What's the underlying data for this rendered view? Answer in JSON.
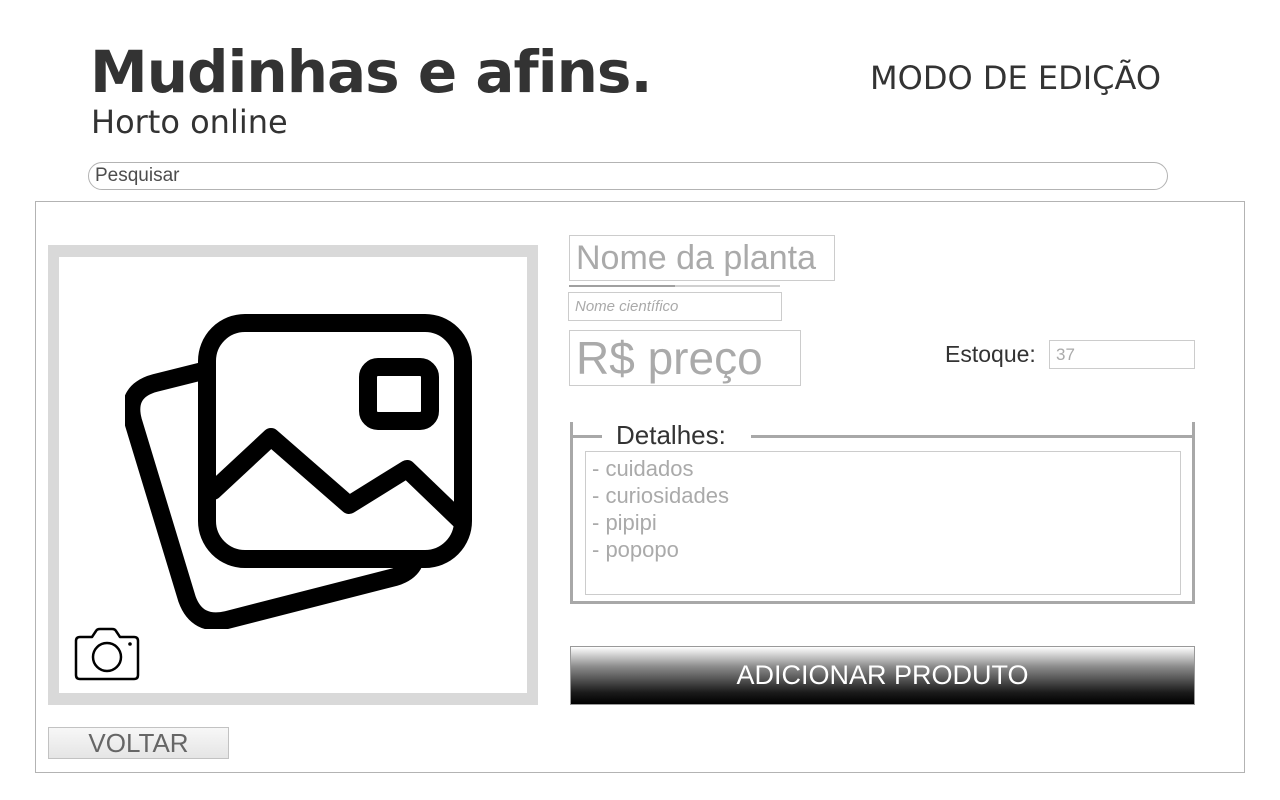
{
  "header": {
    "title": "Mudinhas e afins.",
    "subtitle": "Horto online",
    "mode": "MODO DE EDIÇÃO"
  },
  "search": {
    "placeholder": "Pesquisar",
    "icon": "search"
  },
  "product_form": {
    "image": {
      "placeholder_icon": "image-gallery-icon",
      "upload_icon": "camera-icon"
    },
    "name_placeholder": "Nome da planta",
    "scientific_name_placeholder": "Nome científico",
    "price_placeholder": "R$ preço",
    "stock": {
      "label": "Estoque:",
      "placeholder": "37"
    },
    "details": {
      "legend": "Detalhes:",
      "items": [
        "- cuidados",
        "- curiosidades",
        "- pipipi",
        "- popopo"
      ]
    },
    "add_button_label": "ADICIONAR PRODUTO",
    "back_button_label": "VOLTAR"
  },
  "colors": {
    "text_dark": "#333333",
    "placeholder": "#aaaaaa",
    "frame_gray": "#d9d9d9",
    "border_gray": "#b3b3b3",
    "button_dark": "#000000"
  }
}
